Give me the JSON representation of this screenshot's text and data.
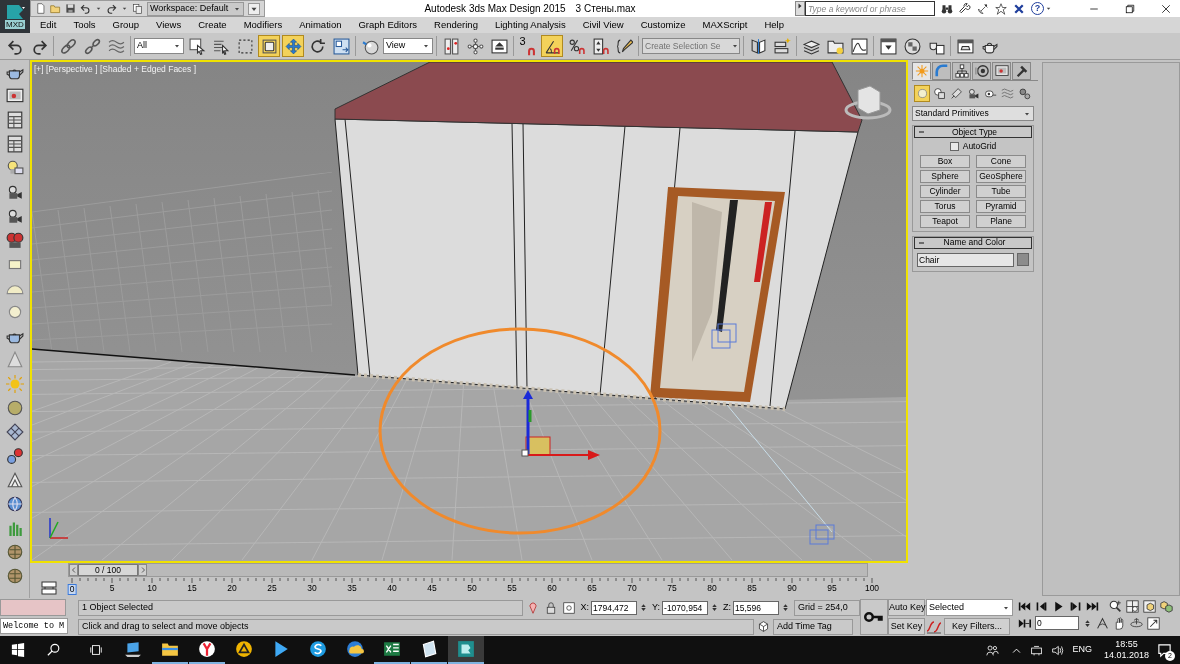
{
  "app_button": {
    "label": "MXD"
  },
  "quick_access": {
    "workspace": "Workspace: Default"
  },
  "title": "Autodesk 3ds Max Design 2015",
  "file_name": "3 Стены.max",
  "search": {
    "placeholder": "Type a keyword or phrase",
    "help": "?"
  },
  "menu": [
    "Edit",
    "Tools",
    "Group",
    "Views",
    "Create",
    "Modifiers",
    "Animation",
    "Graph Editors",
    "Rendering",
    "Lighting Analysis",
    "Civil View",
    "Customize",
    "MAXScript",
    "Help"
  ],
  "toolbar": [
    {
      "kind": "tool",
      "active": false
    },
    {
      "kind": "tool",
      "active": false
    },
    {
      "kind": "tool",
      "active": false
    },
    {
      "kind": "tool",
      "active": false
    },
    {
      "kind": "tool",
      "active": false
    },
    {
      "kind": "dropdown",
      "value": "All"
    },
    {
      "kind": "tool",
      "active": false
    },
    {
      "kind": "tool",
      "active": false
    },
    {
      "kind": "tool",
      "active": false
    },
    {
      "kind": "tool",
      "active": true
    },
    {
      "kind": "tool",
      "active": true
    },
    {
      "kind": "tool",
      "active": false
    },
    {
      "kind": "tool",
      "active": false
    },
    {
      "kind": "tool",
      "active": false
    },
    {
      "kind": "dropdown",
      "value": "View"
    },
    {
      "kind": "tool",
      "active": false
    },
    {
      "kind": "tool",
      "active": false
    },
    {
      "kind": "tool",
      "active": false
    },
    {
      "kind": "snap",
      "label": "3",
      "active": false
    },
    {
      "kind": "tool",
      "active": true
    },
    {
      "kind": "tool",
      "active": false
    },
    {
      "kind": "tool",
      "active": false
    },
    {
      "kind": "tool",
      "active": false
    },
    {
      "kind": "combo",
      "placeholder": "Create Selection Se"
    },
    {
      "kind": "tool",
      "active": false
    },
    {
      "kind": "tool",
      "active": false
    },
    {
      "kind": "tool",
      "active": false
    },
    {
      "kind": "tool",
      "active": false
    },
    {
      "kind": "tool",
      "active": false
    },
    {
      "kind": "tool",
      "active": false
    },
    {
      "kind": "tool",
      "active": false
    },
    {
      "kind": "tool",
      "active": false
    },
    {
      "kind": "tool",
      "active": false
    },
    {
      "kind": "tool",
      "active": false
    }
  ],
  "viewport": {
    "label": "[+] [Perspective ] [Shaded + Edged Faces ]"
  },
  "command_panel": {
    "tabs": [
      {
        "selected": true
      },
      {
        "selected": false
      },
      {
        "selected": false
      },
      {
        "selected": false
      },
      {
        "selected": false
      },
      {
        "selected": false
      }
    ],
    "categories": [
      {
        "selected": true
      },
      {
        "selected": false
      },
      {
        "selected": false
      },
      {
        "selected": false
      },
      {
        "selected": false
      },
      {
        "selected": false
      },
      {
        "selected": false
      }
    ],
    "category_dropdown": "Standard Primitives",
    "object_type": {
      "title": "Object Type",
      "autogrid": {
        "label": "AutoGrid",
        "checked": false
      },
      "buttons": [
        "Box",
        "Cone",
        "Sphere",
        "GeoSphere",
        "Cylinder",
        "Tube",
        "Torus",
        "Pyramid",
        "Teapot",
        "Plane"
      ]
    },
    "name_and_color": {
      "title": "Name and Color",
      "name": "Chair",
      "color": "#8c8c8c"
    }
  },
  "time_slider": {
    "label": "0 / 100",
    "level": 0
  },
  "track_bar": {
    "ticks": [
      "0",
      "5",
      "10",
      "15",
      "20",
      "25",
      "30",
      "35",
      "40",
      "45",
      "50",
      "55",
      "60",
      "65",
      "70",
      "75",
      "80",
      "85",
      "90",
      "95",
      "100"
    ]
  },
  "listener": {
    "output": "Welcome to M"
  },
  "status": {
    "selection": "1 Object Selected",
    "prompt": "Click and drag to select and move objects",
    "coords": [
      {
        "axis": "X:",
        "value": "1794,472"
      },
      {
        "axis": "Y:",
        "value": "-1070,954"
      },
      {
        "axis": "Z:",
        "value": "15,596"
      }
    ],
    "grid": "Grid = 254,0",
    "time_tag": "Add Time Tag"
  },
  "animation": {
    "auto_key": "Auto Key",
    "set_key": "Set Key",
    "key_set": "Selected",
    "key_filters": "Key Filters...",
    "frame": "0"
  },
  "taskbar": {
    "apps": [
      {
        "active": false,
        "running": false
      },
      {
        "active": false,
        "running": true
      },
      {
        "active": false,
        "running": true
      },
      {
        "active": false,
        "running": false
      },
      {
        "active": false,
        "running": false
      },
      {
        "active": false,
        "running": false
      },
      {
        "active": false,
        "running": false
      },
      {
        "active": false,
        "running": true
      },
      {
        "active": false,
        "running": true
      },
      {
        "active": true,
        "running": true
      }
    ],
    "language": "ENG",
    "time": "18:55",
    "date": "14.01.2018",
    "notifications": "2"
  }
}
